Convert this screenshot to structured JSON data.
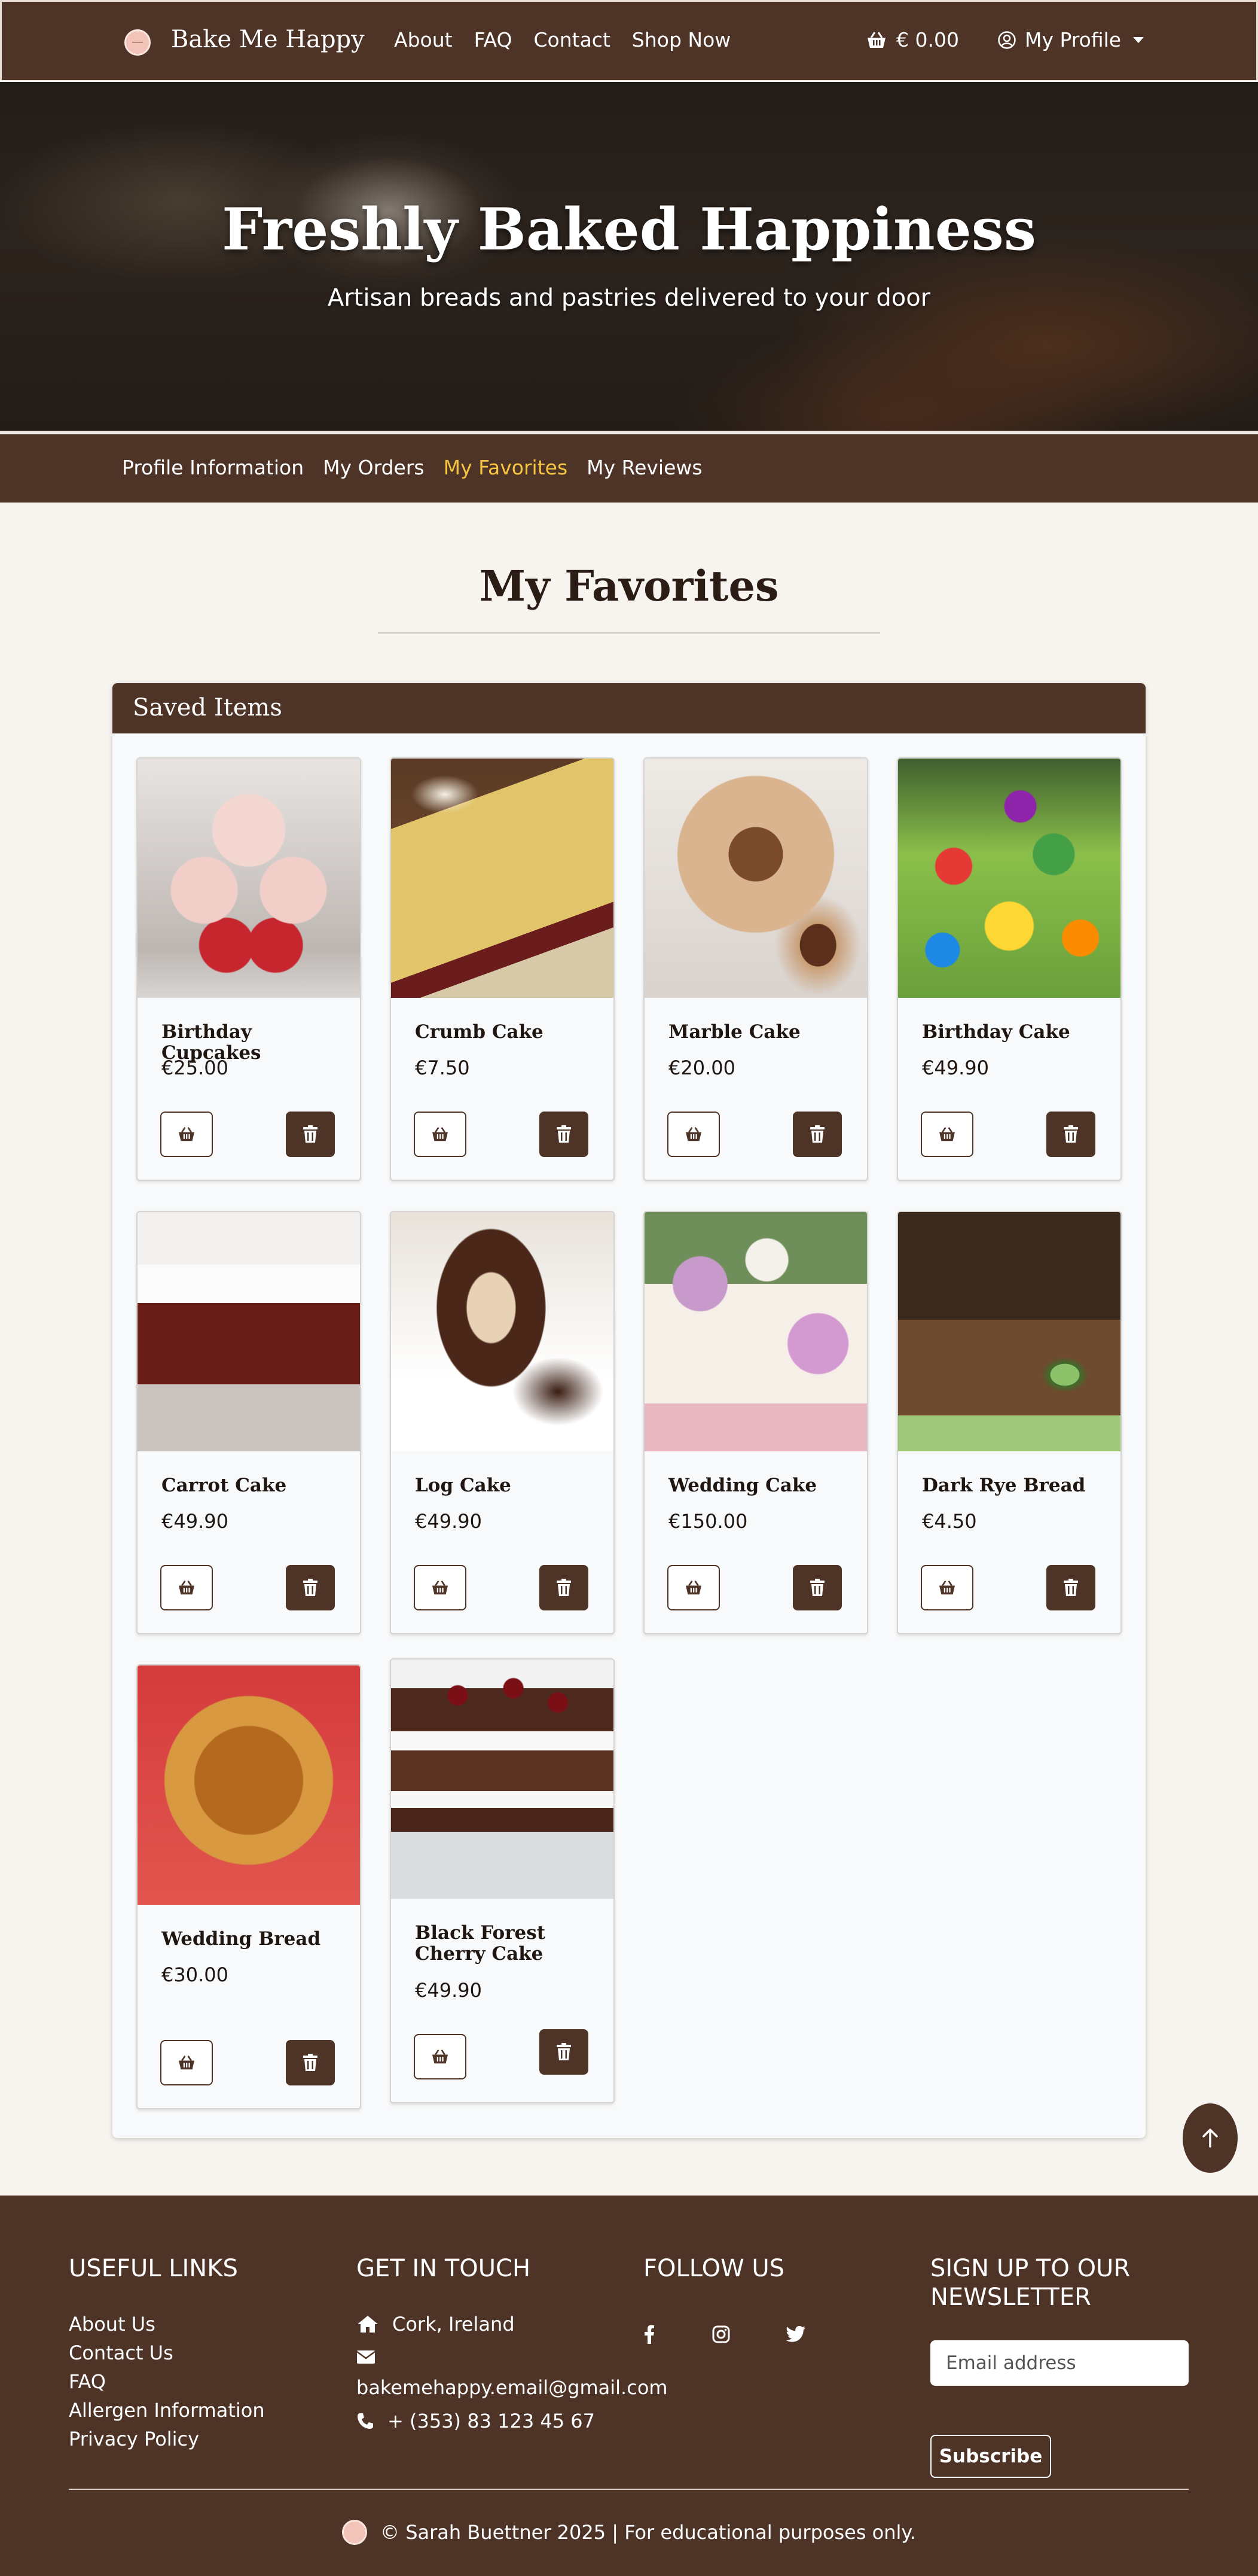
{
  "navbar": {
    "brand": "Bake Me Happy",
    "links": [
      "About",
      "FAQ",
      "Contact",
      "Shop Now"
    ],
    "cart_total": "€ 0.00",
    "profile_label": "My Profile"
  },
  "hero": {
    "title": "Freshly Baked Happiness",
    "subtitle": "Artisan breads and pastries delivered to your door"
  },
  "profile_tabs": {
    "items": [
      "Profile Information",
      "My Orders",
      "My Favorites",
      "My Reviews"
    ],
    "active": "My Favorites"
  },
  "page": {
    "title": "My Favorites",
    "card_title": "Saved Items"
  },
  "favorites": [
    {
      "name": "Birthday Cupcakes",
      "price": "€25.00",
      "image": "cupcakes-photo"
    },
    {
      "name": "Crumb Cake",
      "price": "€7.50",
      "image": "crumb-cake-photo"
    },
    {
      "name": "Marble Cake",
      "price": "€20.00",
      "image": "marble-cake-photo"
    },
    {
      "name": "Birthday Cake",
      "price": "€49.90",
      "image": "birthday-cake-photo"
    },
    {
      "name": "Carrot Cake",
      "price": "€49.90",
      "image": "carrot-cake-photo"
    },
    {
      "name": "Log Cake",
      "price": "€49.90",
      "image": "log-cake-photo"
    },
    {
      "name": "Wedding Cake",
      "price": "€150.00",
      "image": "wedding-cake-photo"
    },
    {
      "name": "Dark Rye Bread",
      "price": "€4.50",
      "image": "rye-bread-photo"
    },
    {
      "name": "Wedding Bread",
      "price": "€30.00",
      "image": "wedding-bread-photo"
    },
    {
      "name": "Black Forest Cherry Cake",
      "price": "€49.90",
      "image": "black-forest-cake-photo"
    }
  ],
  "icons": {
    "add_to_basket": "basket-icon",
    "remove": "trash-icon",
    "scroll_top": "arrow-up-icon"
  },
  "footer": {
    "useful_links": {
      "heading": "USEFUL LINKS",
      "items": [
        "About Us",
        "Contact Us",
        "FAQ",
        "Allergen Information",
        "Privacy Policy"
      ]
    },
    "get_in_touch": {
      "heading": "GET IN TOUCH",
      "location": "Cork, Ireland",
      "email": "bakemehappy.email@gmail.com",
      "phone": "+ (353) 83 123 45 67"
    },
    "follow_us": {
      "heading": "FOLLOW US",
      "networks": [
        "facebook-icon",
        "instagram-icon",
        "twitter-icon"
      ]
    },
    "newsletter": {
      "heading_line1": "SIGN UP TO OUR",
      "heading_line2": "NEWSLETTER",
      "placeholder": "Email address",
      "button": "Subscribe"
    },
    "copyright": "© Sarah Buettner 2025 | For educational purposes only."
  },
  "colors": {
    "brand_brown": "#4e3327",
    "active_tab": "#f6c542",
    "page_background": "#f7f3ef"
  }
}
